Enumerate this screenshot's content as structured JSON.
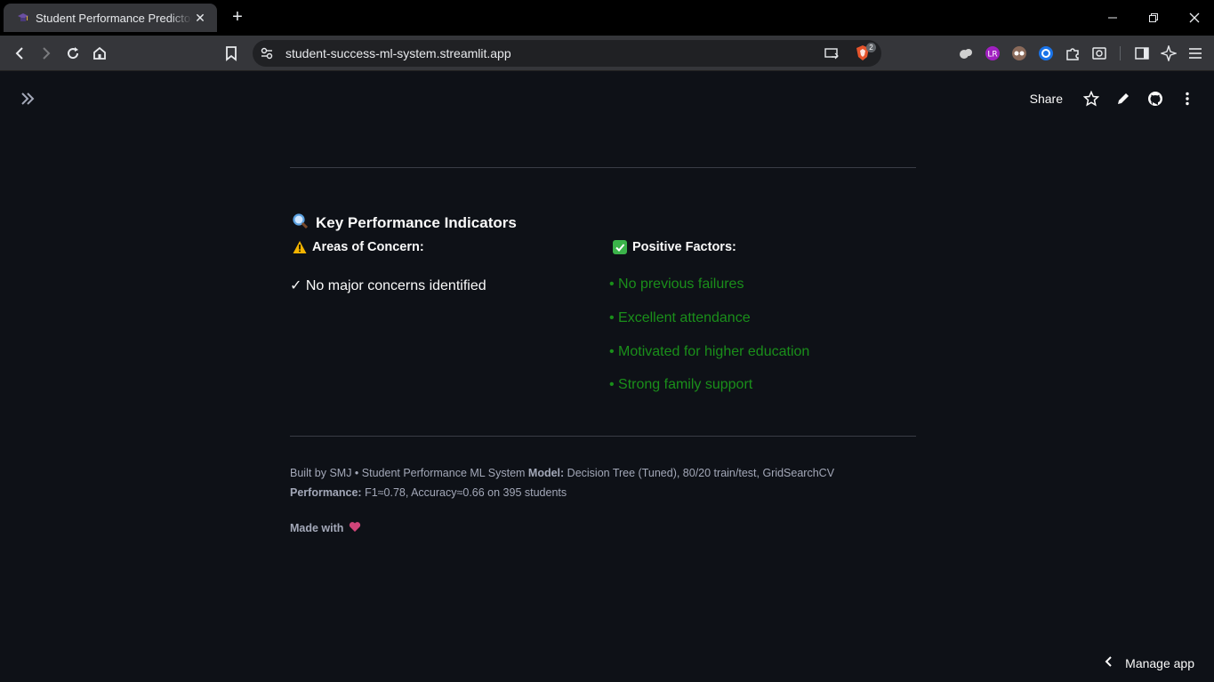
{
  "browser": {
    "tab_title": "Student Performance Predictor · Streamlit",
    "url": "student-success-ml-system.streamlit.app",
    "brave_badge": "2"
  },
  "header": {
    "share_label": "Share"
  },
  "kpi": {
    "title": "Key Performance Indicators",
    "concerns_heading": "Areas of Concern:",
    "positive_heading": "Positive Factors:",
    "concern_items": [
      "✓ No major concerns identified"
    ],
    "positive_items": [
      "• No previous failures",
      "• Excellent attendance",
      "• Motivated for higher education",
      "• Strong family support"
    ]
  },
  "footer": {
    "line1_prefix": "Built by SMJ • Student Performance ML System ",
    "line1_bold": "Model:",
    "line1_suffix": " Decision Tree (Tuned), 80/20 train/test, GridSearchCV",
    "line2_bold": "Performance:",
    "line2_suffix": " F1≈0.78, Accuracy≈0.66 on 395 students",
    "made_with": "Made with"
  },
  "manage_app_label": "Manage app",
  "colors": {
    "positive_green": "#1a8f1a",
    "page_bg": "#0e1117",
    "muted_text": "#a3a8b8"
  }
}
